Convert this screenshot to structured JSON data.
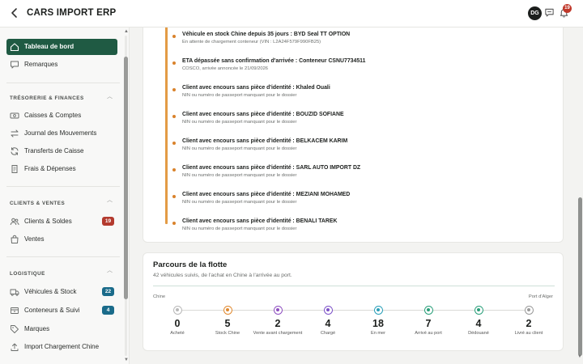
{
  "header": {
    "title": "CARS IMPORT ERP",
    "avatar_initials": "DG",
    "notification_count": "19"
  },
  "sidebar": {
    "items_top": [
      {
        "label": "Tableau de bord",
        "icon": "home-icon",
        "active": true
      },
      {
        "label": "Remarques",
        "icon": "comment-icon",
        "active": false
      }
    ],
    "sections": [
      {
        "title": "TRÉSORERIE & FINANCES",
        "items": [
          {
            "label": "Caisses & Comptes",
            "icon": "cash-icon"
          },
          {
            "label": "Journal des Mouvements",
            "icon": "transfer-icon"
          },
          {
            "label": "Transferts de Caisse",
            "icon": "refresh-icon"
          },
          {
            "label": "Frais & Dépenses",
            "icon": "receipt-icon"
          }
        ]
      },
      {
        "title": "CLIENTS & VENTES",
        "items": [
          {
            "label": "Clients & Soldes",
            "icon": "users-icon",
            "count": "19",
            "count_color": "#b33a2e"
          },
          {
            "label": "Ventes",
            "icon": "bag-icon"
          }
        ]
      },
      {
        "title": "LOGISTIQUE",
        "items": [
          {
            "label": "Véhicules & Stock",
            "icon": "truck-icon",
            "count": "22",
            "count_color": "#1a6b8a"
          },
          {
            "label": "Conteneurs & Suivi",
            "icon": "box-icon",
            "count": "4",
            "count_color": "#1a6b8a"
          },
          {
            "label": "Marques",
            "icon": "tag-icon"
          },
          {
            "label": "Import Chargement Chine",
            "icon": "upload-icon"
          }
        ]
      }
    ]
  },
  "alerts": [
    {
      "title": "Véhicule en stock Chine depuis 35 jours : BYD Seal TT OPTION",
      "sub": "En attente de chargement conteneur (VIN : L2A24F579F990FB25)"
    },
    {
      "title": "ETA dépassée sans confirmation d'arrivée : Conteneur CSNU7734511",
      "sub": "COSCO, arrivée annoncée le 21/09/2026"
    },
    {
      "title": "Client avec encours sans pièce d'identité : Khaled Ouali",
      "sub": "NIN ou numéro de passeport manquant pour le dossier"
    },
    {
      "title": "Client avec encours sans pièce d'identité : BOUZID SOFIANE",
      "sub": "NIN ou numéro de passeport manquant pour le dossier"
    },
    {
      "title": "Client avec encours sans pièce d'identité : BELKACEM KARIM",
      "sub": "NIN ou numéro de passeport manquant pour le dossier"
    },
    {
      "title": "Client avec encours sans pièce d'identité : SARL AUTO IMPORT DZ",
      "sub": "NIN ou numéro de passeport manquant pour le dossier"
    },
    {
      "title": "Client avec encours sans pièce d'identité : MEZIANI MOHAMED",
      "sub": "NIN ou numéro de passeport manquant pour le dossier"
    },
    {
      "title": "Client avec encours sans pièce d'identité : BENALI TAREK",
      "sub": "NIN ou numéro de passeport manquant pour le dossier"
    }
  ],
  "fleet": {
    "title": "Parcours de la flotte",
    "subtitle": "42 véhicules suivis, de l'achat en Chine à l'arrivée au port.",
    "start_label": "Chine",
    "end_label": "Port d'Alger",
    "stages": [
      {
        "count": "0",
        "label": "Acheté",
        "color": "#b8b8b8"
      },
      {
        "count": "5",
        "label": "Stock Chine",
        "color": "#e0892f"
      },
      {
        "count": "2",
        "label": "Vente avant chargement",
        "color": "#8e4fc0"
      },
      {
        "count": "4",
        "label": "Chargé",
        "color": "#7d52c8"
      },
      {
        "count": "18",
        "label": "En mer",
        "color": "#2a9fb8"
      },
      {
        "count": "7",
        "label": "Arrivé au port",
        "color": "#2a9f7a"
      },
      {
        "count": "4",
        "label": "Dédouané",
        "color": "#2a9f7a"
      },
      {
        "count": "2",
        "label": "Livré au client",
        "color": "#9a9a9a"
      }
    ]
  }
}
